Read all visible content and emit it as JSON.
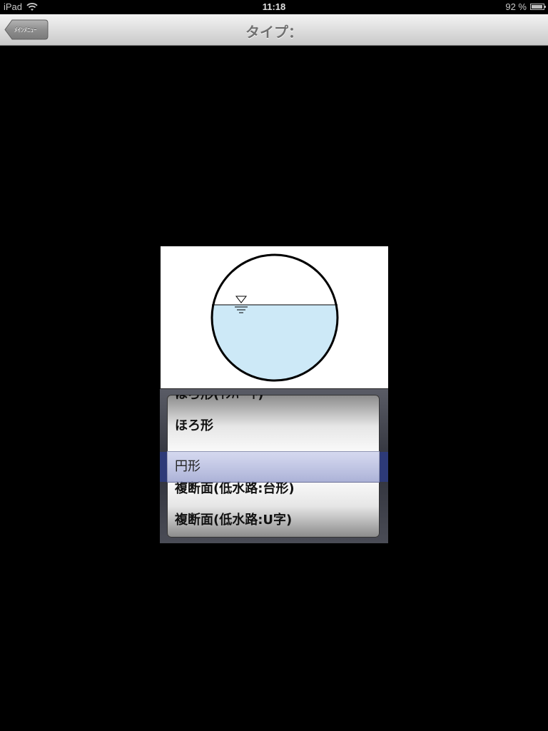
{
  "status_bar": {
    "carrier": "iPad",
    "time": "11:18",
    "battery_percent_label": "92 %",
    "battery_level": 0.92,
    "wifi_icon": "wifi-icon",
    "battery_icon": "battery-icon"
  },
  "nav_bar": {
    "title": "タイプ：",
    "back_label": "ﾒｲﾝﾒﾆｭｰ"
  },
  "picker": {
    "items": [
      "ほろ形(ｲﾝﾊﾞｰﾄ)",
      "ほろ形",
      "円形",
      "複断面(低水路:台形)",
      "複断面(低水路:U字)"
    ],
    "selected_index": 2,
    "selected_label": "円形"
  },
  "colors": {
    "water": "#cde9f7",
    "selection": "#a9afd6"
  }
}
